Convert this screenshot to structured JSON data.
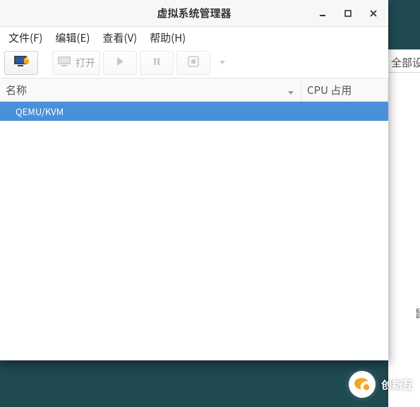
{
  "window": {
    "title": "虚拟系统管理器"
  },
  "menubar": {
    "file": "文件(F)",
    "edit": "编辑(E)",
    "view": "查看(V)",
    "help": "帮助(H)"
  },
  "toolbar": {
    "open_label": "打开"
  },
  "columns": {
    "name": "名称",
    "cpu": "CPU 占用"
  },
  "connections": [
    {
      "label": "QEMU/KVM",
      "selected": true
    }
  ],
  "background_window": {
    "all_settings": "全部设",
    "mouse": "鼠"
  },
  "watermark": {
    "text": "创新互"
  },
  "colors": {
    "selection": "#4a90d9",
    "accent_orange": "#f6a623"
  }
}
